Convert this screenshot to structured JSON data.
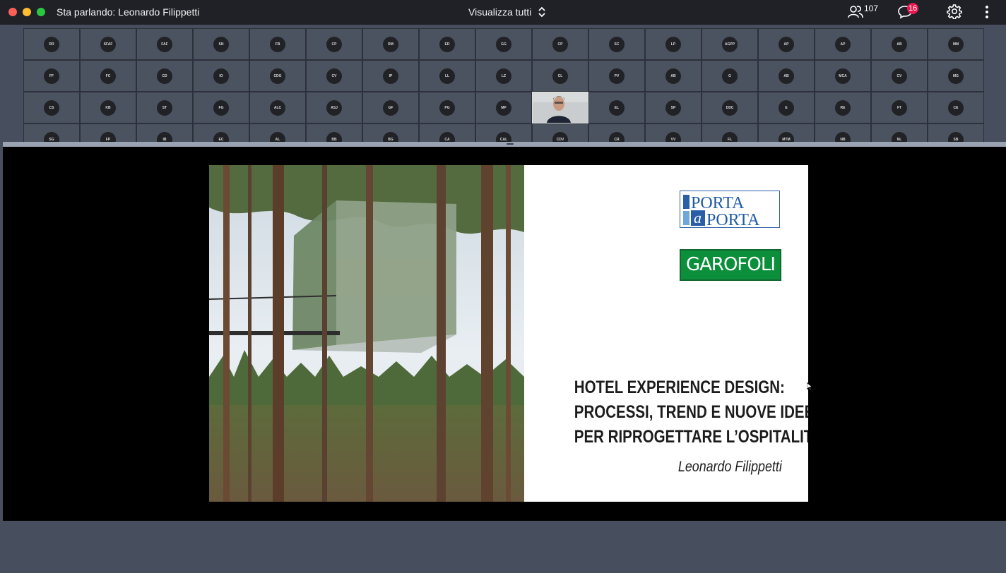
{
  "window": {
    "speaking_label": "Sta parlando: Leonardo Filippetti",
    "view_all_label": "Visualizza tutti",
    "participants_count": "107",
    "chat_badge": "16",
    "icons": {
      "participants": "people-icon",
      "chat": "chat-bubble-icon",
      "settings": "gear-icon",
      "more": "more-vertical-icon",
      "view_switch": "chevron-up-down-icon"
    }
  },
  "participants": {
    "row1": [
      "RR",
      "SFAF",
      "FAF",
      "SN",
      "FB",
      "CP",
      "RM",
      "ED",
      "GG",
      "CP",
      "SC",
      "LP",
      "AGPP",
      "AP",
      "AP",
      "AB",
      "MM"
    ],
    "row2": [
      "FF",
      "FC",
      "CD",
      "IO",
      "CDG",
      "CV",
      "IP",
      "LL",
      "LZ",
      "CL",
      "PV",
      "AB",
      "G",
      "AB",
      "MCA",
      "CV",
      "MG"
    ],
    "row3": [
      "CS",
      "KB",
      "ST",
      "FG",
      "ALC",
      "ASJ",
      "GF",
      "PG",
      "MP",
      "",
      "EL",
      "SP",
      "DDC",
      "E",
      "RE",
      "FT",
      "CE"
    ],
    "row4": [
      "SG",
      "FP",
      "IB",
      "EC",
      "AL",
      "BB",
      "BG",
      "CA",
      "CAL",
      "CDV",
      "CR",
      "VV",
      "FL",
      "MTM",
      "NB",
      "NL",
      "SB"
    ],
    "video_tile_index": 9
  },
  "slide": {
    "logo1_line1": "PORTA",
    "logo1_a": "a",
    "logo1_line2": "PORTA",
    "logo2": "GAROFOLI",
    "title_lines": [
      "HOTEL EXPERIENCE DESIGN:",
      "PROCESSI, TREND E NUOVE IDEE",
      "PER RIPROGETTARE L’OSPITALITÀ"
    ],
    "author": "Leonardo Filippetti"
  },
  "colors": {
    "topbar": "#1f2127",
    "background": "#474e5d",
    "badge": "#e8194f",
    "garofoli_green": "#0b8f3a",
    "porta_blue": "#1f5aa6"
  }
}
